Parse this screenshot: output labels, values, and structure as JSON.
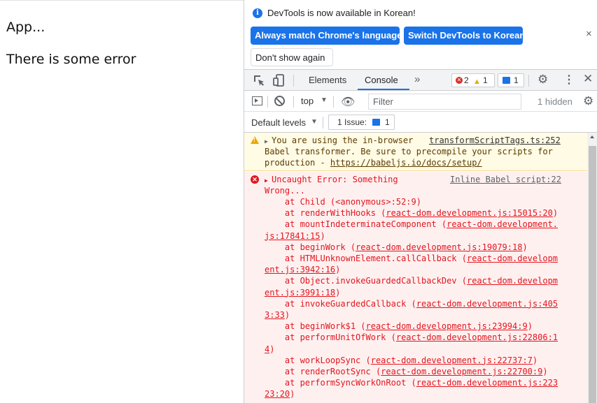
{
  "page": {
    "app_text": "App...",
    "error_text": "There is some error"
  },
  "infobar": {
    "message": "DevTools is now available in Korean!",
    "btn_match": "Always match Chrome's language",
    "btn_switch": "Switch DevTools to Korean",
    "btn_dont_show": "Don't show again",
    "close_glyph": "×"
  },
  "toolbar": {
    "tabs": [
      "Elements",
      "Console"
    ],
    "active_tab": "Console",
    "more_glyph": "»",
    "error_count": "2",
    "warning_count": "1",
    "issue_count": "1"
  },
  "console_toolbar": {
    "context": "top",
    "filter_placeholder": "Filter",
    "hidden": "1 hidden"
  },
  "levels_bar": {
    "levels": "Default levels",
    "issues_label": "1 Issue:",
    "issues_count": "1"
  },
  "messages": {
    "warning": {
      "line1": "You are using the in-browser",
      "line2": "Babel transformer. Be sure to precompile your scripts for",
      "line3_prefix": "production - ",
      "link": "https://babeljs.io/docs/setup/",
      "source": "transformScriptTags.ts:252"
    },
    "error": {
      "line1": "Uncaught Error: Something",
      "line2": "Wrong...",
      "source": "Inline Babel script:22",
      "trace": [
        {
          "prefix": "    at Child (<anonymous>:52:9)",
          "link": "",
          "suffix": ""
        },
        {
          "prefix": "    at renderWithHooks (",
          "link": "react-dom.development.js:15015:20",
          "suffix": ")"
        },
        {
          "prefix": "    at mountIndeterminateComponent (",
          "link": "react-dom.development.",
          "suffix": ""
        },
        {
          "prefix": "",
          "link": "js:17841:15",
          "suffix": ")"
        },
        {
          "prefix": "    at beginWork (",
          "link": "react-dom.development.js:19079:18",
          "suffix": ")"
        },
        {
          "prefix": "    at HTMLUnknownElement.callCallback (",
          "link": "react-dom.developm",
          "suffix": ""
        },
        {
          "prefix": "",
          "link": "ent.js:3942:16",
          "suffix": ")"
        },
        {
          "prefix": "    at Object.invokeGuardedCallbackDev (",
          "link": "react-dom.developm",
          "suffix": ""
        },
        {
          "prefix": "",
          "link": "ent.js:3991:18",
          "suffix": ")"
        },
        {
          "prefix": "    at invokeGuardedCallback (",
          "link": "react-dom.development.js:405",
          "suffix": ""
        },
        {
          "prefix": "",
          "link": "3:33",
          "suffix": ")"
        },
        {
          "prefix": "    at beginWork$1 (",
          "link": "react-dom.development.js:23994:9",
          "suffix": ")"
        },
        {
          "prefix": "    at performUnitOfWork (",
          "link": "react-dom.development.js:22806:1",
          "suffix": ""
        },
        {
          "prefix": "",
          "link": "4",
          "suffix": ")"
        },
        {
          "prefix": "    at workLoopSync (",
          "link": "react-dom.development.js:22737:7",
          "suffix": ")"
        },
        {
          "prefix": "    at renderRootSync (",
          "link": "react-dom.development.js:22700:9",
          "suffix": ")"
        },
        {
          "prefix": "    at performSyncWorkOnRoot (",
          "link": "react-dom.development.js:223",
          "suffix": ""
        },
        {
          "prefix": "",
          "link": "23:20",
          "suffix": ")"
        }
      ]
    }
  },
  "colors": {
    "accent": "#1a73e8",
    "error_text": "#e0161e",
    "error_bg": "#fff0f0",
    "warning_bg": "#fffbe5"
  }
}
